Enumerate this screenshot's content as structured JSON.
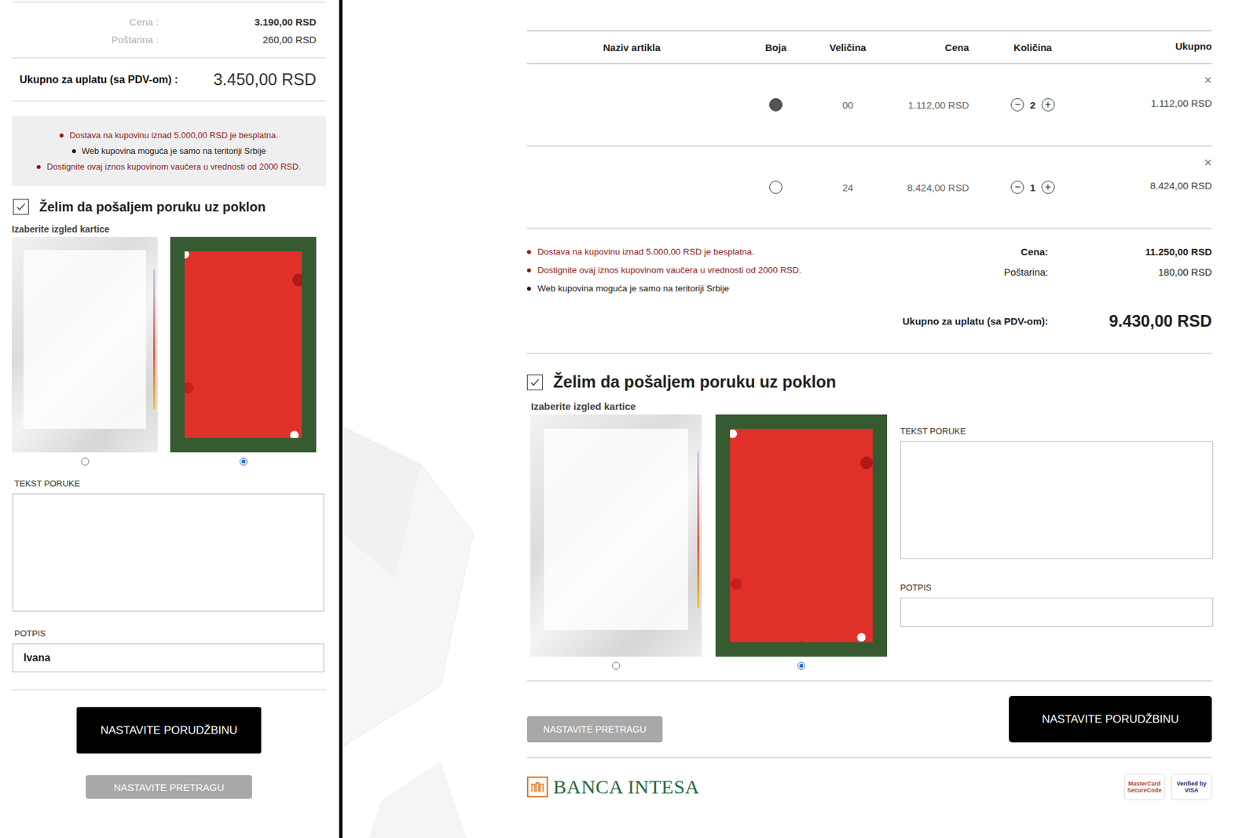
{
  "mobile": {
    "summary": [
      {
        "label": "Cena :",
        "value": "3.190,00 RSD"
      },
      {
        "label": "Poštarina :",
        "value": "260,00 RSD"
      }
    ],
    "total": {
      "label": "Ukupno za uplatu (sa PDV-om) :",
      "value": "3.450,00 RSD"
    },
    "notices": [
      {
        "text": "Dostava na kupovinu iznad 5.000,00 RSD je besplatna.",
        "color": "#8e1b1b"
      },
      {
        "text": "Web kupovina moguća je samo na teritoriji Srbije",
        "color": "#1a1a1a"
      },
      {
        "text": "Dostignite ovaj iznos kupovinom vaučera u vrednosti od 2000 RSD.",
        "color": "#8e1b1b"
      }
    ],
    "gift": {
      "label": "Želim da pošaljem poruku uz poklon",
      "checked": true,
      "card_label": "Izaberite izgled kartice",
      "cards": [
        {
          "kind": "silver",
          "selected": false
        },
        {
          "kind": "christmas",
          "selected": true
        }
      ],
      "message_label": "TEKST PORUKE",
      "message": "",
      "signature_label": "POTPIS",
      "signature": "Ivana"
    },
    "buttons": {
      "primary": "NASTAVITE PORUDŽBINU",
      "secondary": "NASTAVITE PRETRAGU"
    }
  },
  "desktop": {
    "columns": [
      "Naziv artikla",
      "Boja",
      "Veličina",
      "Cena",
      "Količina",
      "Ukupno"
    ],
    "rows": [
      {
        "color": "#555555",
        "size": "00",
        "price": "1.112,00 RSD",
        "quantity": "2",
        "total": "1.112,00 RSD",
        "remove": "×",
        "minus": "−",
        "plus": "+"
      },
      {
        "color": "#ffffff",
        "size": "24",
        "price": "8.424,00 RSD",
        "quantity": "1",
        "total": "8.424,00 RSD",
        "remove": "×",
        "minus": "−",
        "plus": "+"
      }
    ],
    "notices": [
      {
        "text": "Dostava na kupovinu iznad 5.000,00 RSD je besplatna.",
        "color": "#8e1b1b"
      },
      {
        "text": "Dostignite ovaj iznos kupovinom vaučera u vrednosti od 2000 RSD.",
        "color": "#8e1b1b"
      },
      {
        "text": "Web kupovina moguća je samo na teritoriji Srbije",
        "color": "#1a1a1a"
      }
    ],
    "summary": [
      {
        "label": "Cena:",
        "value": "11.250,00 RSD"
      },
      {
        "label": "Poštarina:",
        "value": "180,00 RSD"
      }
    ],
    "total": {
      "label": "Ukupno za uplatu (sa PDV-om):",
      "value": "9.430,00 RSD"
    },
    "gift": {
      "label": "Želim da pošaljem poruku uz poklon",
      "checked": true,
      "card_label": "Izaberite izgled kartice",
      "cards": [
        {
          "kind": "silver",
          "selected": false
        },
        {
          "kind": "christmas",
          "selected": true
        }
      ],
      "message_label": "TEKST PORUKE",
      "message": "",
      "signature_label": "POTPIS",
      "signature": ""
    },
    "buttons": {
      "primary": "NASTAVITE PORUDŽBINU",
      "secondary": "NASTAVITE PRETRAGU"
    },
    "payment": {
      "bank": "BANCA INTESA",
      "badges": [
        {
          "lines": [
            "MasterCard",
            "SecureCode"
          ]
        },
        {
          "lines": [
            "Verified by",
            "VISA"
          ]
        }
      ]
    }
  }
}
